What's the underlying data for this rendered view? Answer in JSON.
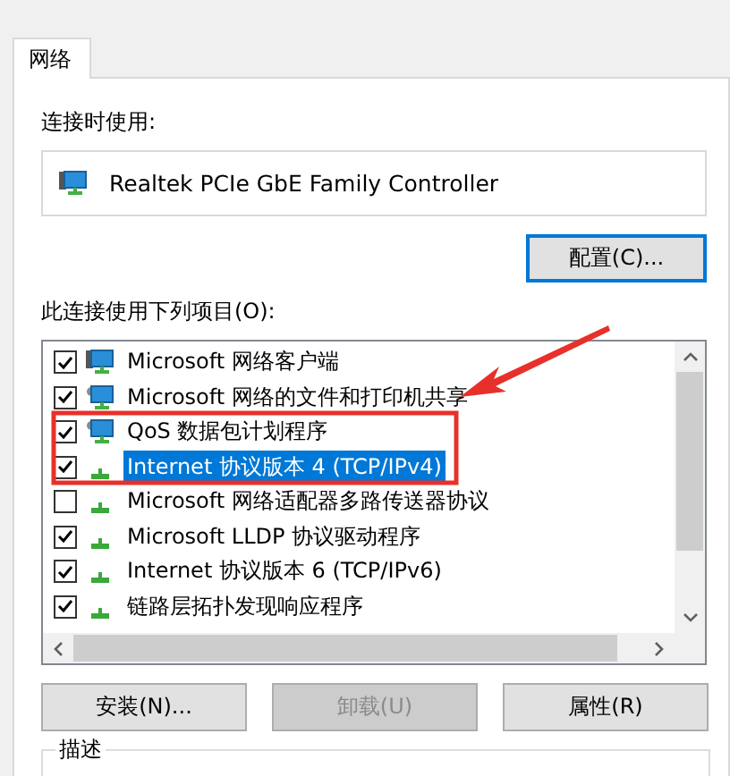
{
  "tabs": [
    {
      "label": "网络",
      "selected": true
    }
  ],
  "connect_using": {
    "label": "连接时使用:",
    "adapter": "Realtek PCIe GbE Family Controller",
    "configure_button": "配置(C)..."
  },
  "items": {
    "label": "此连接使用下列项目(O):",
    "rows": [
      {
        "kind": "client",
        "label": "Microsoft 网络客户端",
        "checked": true,
        "selected": false
      },
      {
        "kind": "service",
        "label": "Microsoft 网络的文件和打印机共享",
        "checked": true,
        "selected": false
      },
      {
        "kind": "service",
        "label": "QoS 数据包计划程序",
        "checked": true,
        "selected": false
      },
      {
        "kind": "protocol",
        "label": "Internet 协议版本 4 (TCP/IPv4)",
        "checked": true,
        "selected": true
      },
      {
        "kind": "protocol",
        "label": "Microsoft 网络适配器多路传送器协议",
        "checked": false,
        "selected": false
      },
      {
        "kind": "protocol",
        "label": "Microsoft LLDP 协议驱动程序",
        "checked": true,
        "selected": false
      },
      {
        "kind": "protocol",
        "label": "Internet 协议版本 6 (TCP/IPv6)",
        "checked": true,
        "selected": false
      },
      {
        "kind": "protocol",
        "label": "链路层拓扑发现响应程序",
        "checked": true,
        "selected": false
      }
    ]
  },
  "buttons": [
    {
      "label": "安装(N)...",
      "disabled": false
    },
    {
      "label": "卸载(U)",
      "disabled": true
    },
    {
      "label": "属性(R)",
      "disabled": false
    }
  ],
  "description": {
    "label": "描述"
  }
}
